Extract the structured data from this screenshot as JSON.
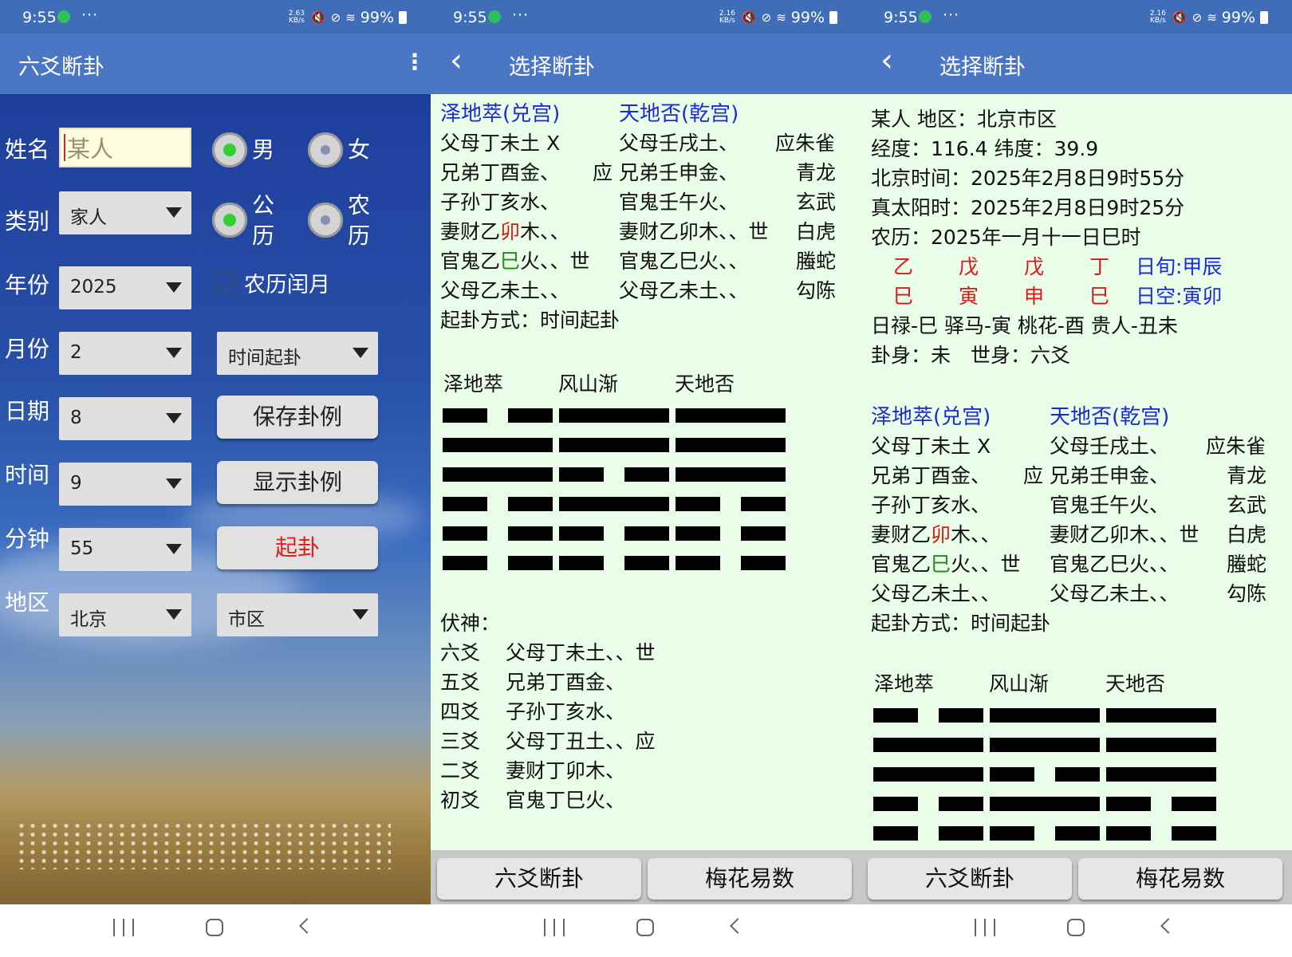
{
  "status": {
    "time": "9:55",
    "more": "···",
    "net1": "2.63 KB/s",
    "net23": "2.16 KB/s",
    "battery": "99%"
  },
  "p1": {
    "title": "六爻断卦",
    "labels": [
      "姓名",
      "类别",
      "年份",
      "月份",
      "日期",
      "时间",
      "分钟",
      "地区"
    ],
    "name_value": "某人",
    "gender": {
      "male": "男",
      "female": "女"
    },
    "calendar": {
      "solar": "公历",
      "lunar": "农历",
      "solar_top": "公",
      "solar_bottom": "历",
      "lunar_top": "农",
      "lunar_bottom": "历"
    },
    "leap": "农历闰月",
    "category": "家人",
    "year": "2025",
    "month": "2",
    "day": "8",
    "hour": "9",
    "minute": "55",
    "region": "北京",
    "subregion": "市区",
    "method": "时间起卦",
    "buttons": {
      "save": "保存卦例",
      "show": "显示卦例",
      "cast": "起卦"
    }
  },
  "p2": {
    "title": "选择断卦",
    "ben_gua": "泽地萃(兑宫)",
    "bian_gua": "天地否(乾宫)",
    "rows": [
      {
        "left": "父母丁未土 X",
        "mid": "",
        "right": "父母壬戌土、",
        "god": "应朱雀"
      },
      {
        "left": "兄弟丁酉金、",
        "mid": "应",
        "right": "兄弟壬申金、",
        "god": "青龙"
      },
      {
        "left": "子孙丁亥水、",
        "mid": "",
        "right": "官鬼壬午火、",
        "god": "玄武"
      },
      {
        "left_a": "妻财乙",
        "left_red": "卯",
        "left_b": "木、、",
        "mid": "",
        "right": "妻财乙卯木、、世",
        "god": "白虎"
      },
      {
        "left_a": "官鬼乙",
        "left_grn": "巳",
        "left_b": "火、、世",
        "mid": "",
        "right": "官鬼乙巳火、、",
        "god": "螣蛇"
      },
      {
        "left": "父母乙未土、、",
        "mid": "",
        "right": "父母乙未土、、",
        "god": "勾陈"
      }
    ],
    "method": "起卦方式：时间起卦",
    "gua_names": [
      "泽地萃",
      "风山渐",
      "天地否"
    ],
    "fushen_title": "伏神：",
    "fushen": [
      {
        "pos": "六爻",
        "val": "父母丁未土、、世"
      },
      {
        "pos": "五爻",
        "val": "兄弟丁酉金、"
      },
      {
        "pos": "四爻",
        "val": "子孙丁亥水、"
      },
      {
        "pos": "三爻",
        "val": "父母丁丑土、、应"
      },
      {
        "pos": "二爻",
        "val": "妻财丁卯木、"
      },
      {
        "pos": "初爻",
        "val": "官鬼丁巳火、"
      }
    ],
    "buttons": {
      "liuyao": "六爻断卦",
      "meihua": "梅花易数"
    }
  },
  "p3": {
    "title": "选择断卦",
    "info": [
      "某人 地区：北京市区",
      "经度：116.4 纬度：39.9",
      "北京时间：2025年2月8日9时55分",
      "真太阳时：2025年2月8日9时25分",
      "农历：2025年一月十一日巳时"
    ],
    "gan": [
      "乙",
      "戊",
      "戊",
      "丁"
    ],
    "zhi": [
      "巳",
      "寅",
      "申",
      "巳"
    ],
    "xun": "日旬:甲辰",
    "kong": "日空:寅卯",
    "shensha": "日禄-巳 驿马-寅 桃花-酉 贵人-丑未",
    "guashen": "卦身：未　世身：六爻"
  },
  "colors": {
    "appbar": "#4a76c4",
    "status": "#3f6db8",
    "content_bg": "#e9fde9",
    "title_blue": "#1a2bd6",
    "red": "#e01515",
    "green": "#1d8a1d"
  },
  "icons": {
    "back": "chevron-left-icon",
    "menu": "kebab-menu-icon",
    "nav": [
      "recent-apps-icon",
      "home-icon",
      "back-nav-icon"
    ]
  }
}
